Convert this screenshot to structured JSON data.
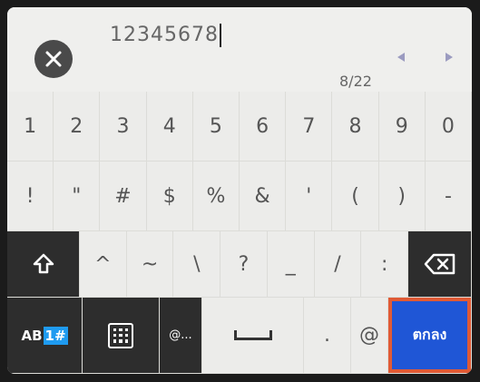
{
  "input": {
    "value": "12345678",
    "counter": "8/22"
  },
  "keys": {
    "row1": [
      "1",
      "2",
      "3",
      "4",
      "5",
      "6",
      "7",
      "8",
      "9",
      "0"
    ],
    "row2": [
      "!",
      "\"",
      "#",
      "$",
      "%",
      "&",
      "'",
      "(",
      ")",
      "-"
    ],
    "row3": [
      "^",
      "~",
      "\\",
      "?",
      "_",
      "/",
      ":"
    ],
    "shift_glyph": "⇧",
    "mode_ab": "AB",
    "mode_num": "1#",
    "at_label": "@...",
    "dot_label": ".",
    "clip_glyph": "@",
    "ok_label": "ตกลง"
  },
  "icons": {
    "clear": "close-icon",
    "shift": "shift-icon",
    "backspace": "backspace-icon",
    "grid": "keypad-grid-icon",
    "space": "space-icon"
  },
  "colors": {
    "ok_bg": "#1f56d6",
    "ok_border": "#e05a35",
    "num_mode_highlight": "#1f9bf0"
  }
}
